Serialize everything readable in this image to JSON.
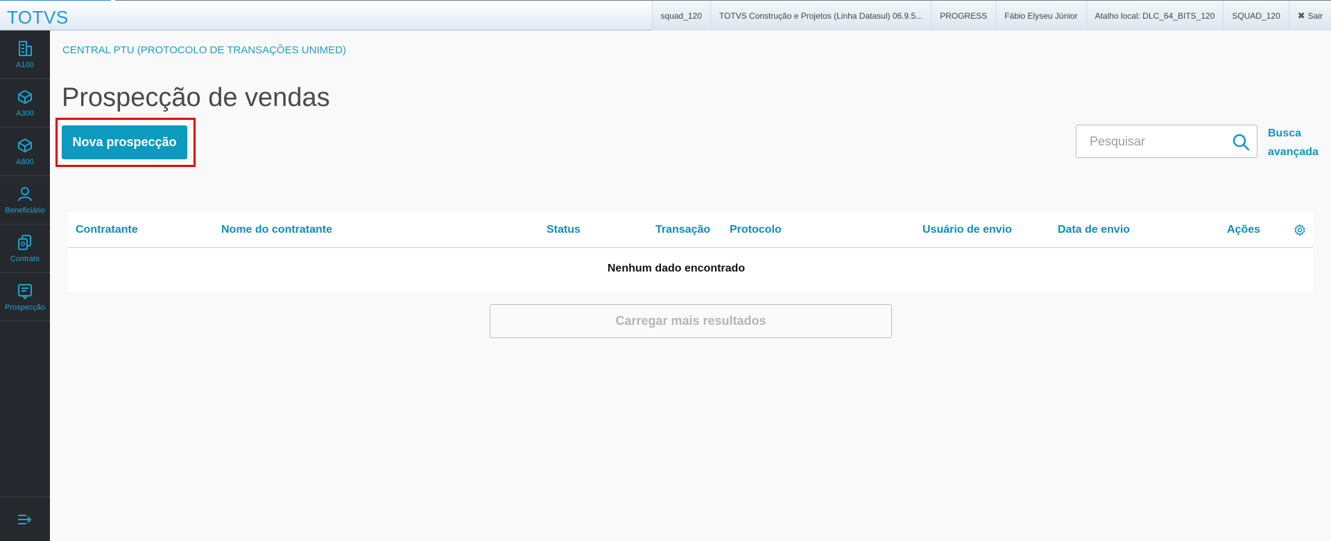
{
  "app": {
    "logo": "TOTVS"
  },
  "topbar": {
    "segments": [
      "squad_120",
      "TOTVS Construção e Projetos (Linha Datasul) 06.9.5...",
      "PROGRESS",
      "Fábio Elyseu Júnior",
      "Atalho local: DLC_64_BITS_120",
      "SQUAD_120"
    ],
    "logout_label": "Sair"
  },
  "sidebar": {
    "items": [
      {
        "label": "A100",
        "icon": "building-icon"
      },
      {
        "label": "A300",
        "icon": "cube-icon"
      },
      {
        "label": "A800",
        "icon": "cube-icon"
      },
      {
        "label": "Beneficiário",
        "icon": "user-icon"
      },
      {
        "label": "Contrato",
        "icon": "documents-icon"
      },
      {
        "label": "Prospecção",
        "icon": "clipboard-icon"
      }
    ],
    "collapse_icon": "menu-collapse-icon",
    "accent": "#1aa5d3",
    "background": "#25292d"
  },
  "breadcrumb": "CENTRAL PTU (PROTOCOLO DE TRANSAÇÕES UNIMED)",
  "page_title": "Prospecção de vendas",
  "actions": {
    "primary_label": "Nova prospecção",
    "primary_color": "#0c9abe"
  },
  "search": {
    "placeholder": "Pesquisar",
    "value": "",
    "advanced_line1": "Busca",
    "advanced_line2": "avançada"
  },
  "table": {
    "columns": [
      "Contratante",
      "Nome do contratante",
      "Status",
      "Transação",
      "Protocolo",
      "Usuário de envio",
      "Data de envio",
      "Ações"
    ],
    "rows": [],
    "empty_message": "Nenhum dado encontrado",
    "settings_icon": "gear-icon"
  },
  "load_more_label": "Carregar mais resultados"
}
